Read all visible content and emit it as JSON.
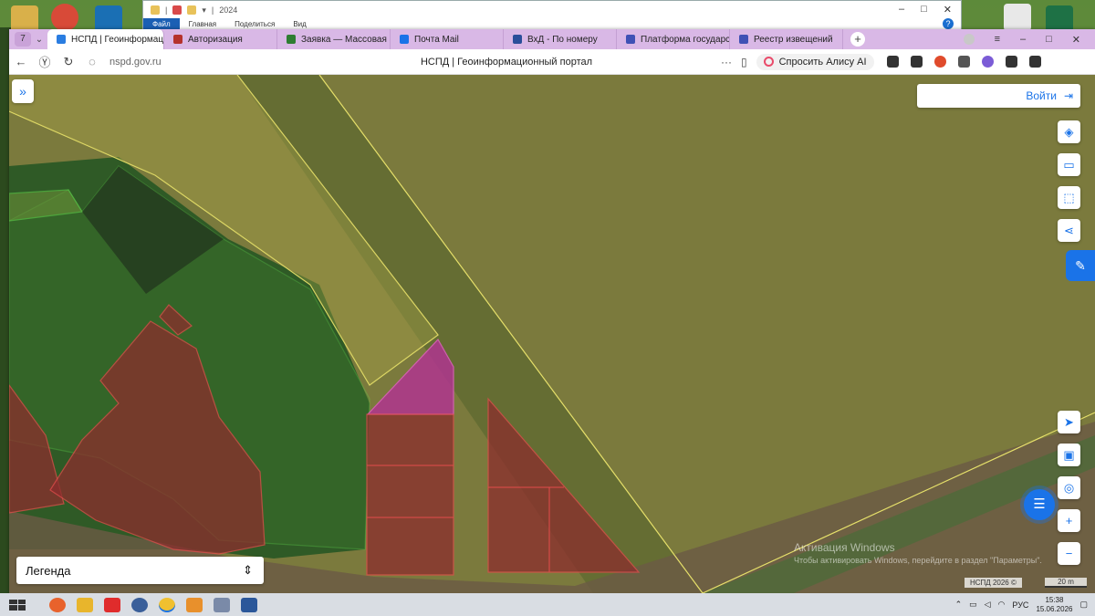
{
  "explorer": {
    "path_label": "2024",
    "ribbon_tabs": [
      "Файл",
      "Главная",
      "Поделиться",
      "Вид"
    ],
    "window_controls": [
      "–",
      "□",
      "✕"
    ],
    "help_label": "?"
  },
  "browser": {
    "tab_count": "7",
    "tabs": [
      {
        "label": "НСПД | Геоинформац",
        "icon_color": "#2a7de1",
        "active": true
      },
      {
        "label": "Авторизация",
        "icon_color": "#b5322c"
      },
      {
        "label": "Заявка — Массовая заяв",
        "icon_color": "#2e7d32"
      },
      {
        "label": "Почта Mail",
        "icon_color": "#1a73e8"
      },
      {
        "label": "ВхД - По номеру",
        "icon_color": "#2a4e9a"
      },
      {
        "label": "Платформа государстве",
        "icon_color": "#3f51b5"
      },
      {
        "label": "Реестр извещений",
        "icon_color": "#3f51b5"
      }
    ],
    "tab_close": "✕",
    "new_tab": "+",
    "window_controls": [
      "≡",
      "–",
      "□",
      "✕"
    ],
    "url": "nspd.gov.ru",
    "page_title": "НСПД | Геоинформационный портал",
    "more": "···",
    "alice_label": "Спросить Алису AI",
    "extension_colors": [
      "#333333",
      "#333333",
      "#e04b2c",
      "#555555",
      "#7b5cd6",
      "#333333",
      "#333333"
    ]
  },
  "map": {
    "login_label": "Войти",
    "legend_label": "Легенда",
    "watermark_title": "Активация Windows",
    "watermark_sub": "Чтобы активировать Windows, перейдите в раздел \"Параметры\".",
    "copyright": "НСПД 2026 ©",
    "scale_label": "20 m",
    "colors": {
      "field": "#7a7a3c",
      "forest": "#2f5a26",
      "forest_overlay": "#3f7a2e",
      "parcel_red": "#8b2d2d",
      "parcel_yellow": "#9a8f3f",
      "parcel_magenta": "#b0358f",
      "accent": "#1a73e8"
    }
  },
  "taskbar": {
    "apps": [
      {
        "name": "firefox",
        "color": "#e8622c"
      },
      {
        "name": "file-explorer",
        "color": "#e8b52c"
      },
      {
        "name": "yandex",
        "color": "#e02c2c"
      },
      {
        "name": "chrome-like",
        "color": "#3a5f9a"
      },
      {
        "name": "yandex-browser",
        "color": "#f0c030"
      },
      {
        "name": "photos",
        "color": "#e8902c"
      },
      {
        "name": "viewer",
        "color": "#7a8aa8"
      },
      {
        "name": "word",
        "color": "#2b579a"
      }
    ],
    "lang": "РУС",
    "time": "15:38",
    "date": "15.06.2026"
  }
}
